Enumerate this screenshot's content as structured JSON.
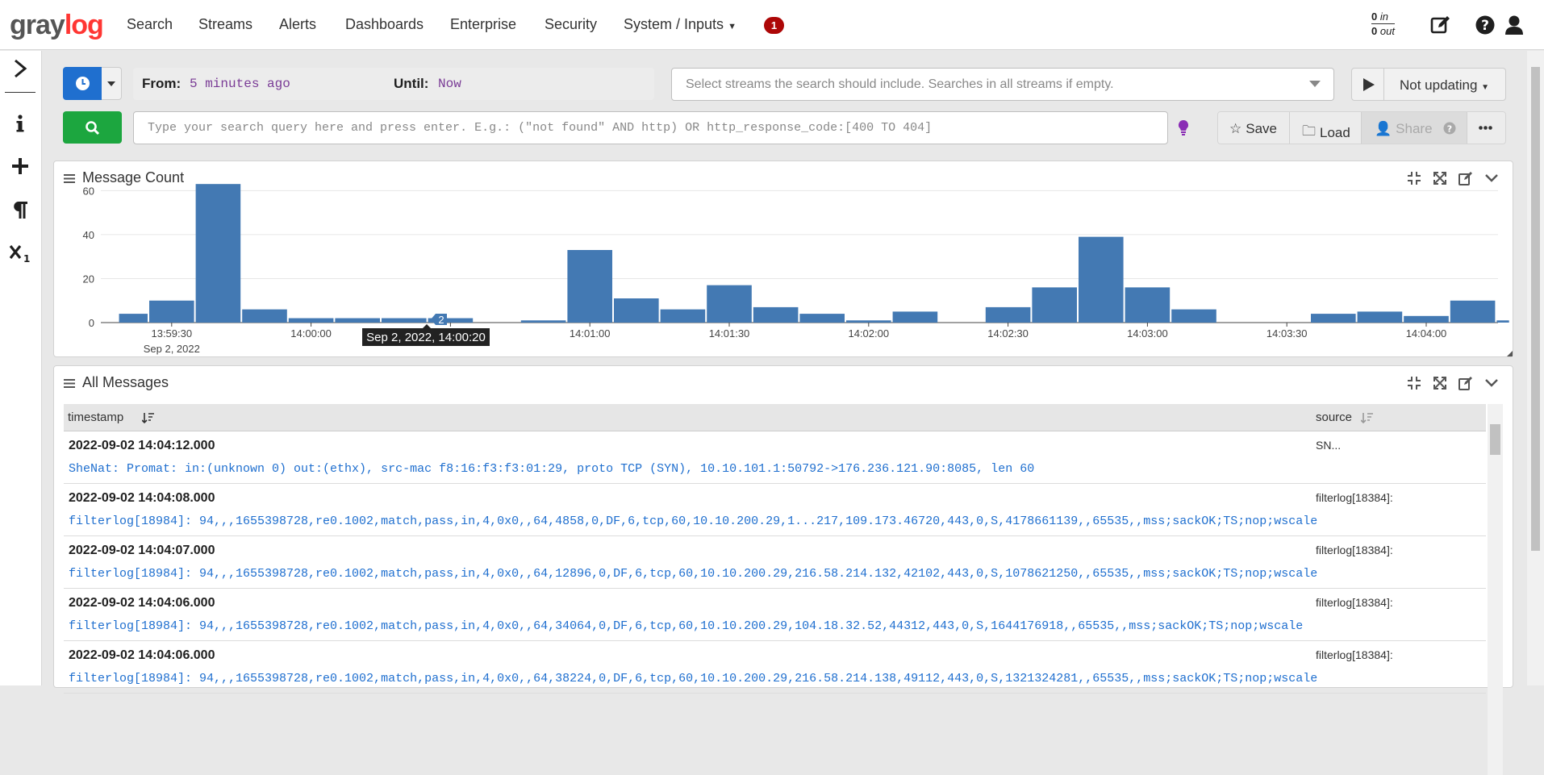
{
  "brand": {
    "part1": "gray",
    "part2": "log"
  },
  "nav": {
    "items": [
      "Search",
      "Streams",
      "Alerts",
      "Dashboards",
      "Enterprise",
      "Security",
      "System / Inputs"
    ],
    "notification_count": "1"
  },
  "throughput": {
    "in_value": "0",
    "in_label": "in",
    "out_value": "0",
    "out_label": "out"
  },
  "search": {
    "from_label": "From:",
    "from_value": "5 minutes ago",
    "until_label": "Until:",
    "until_value": "Now",
    "streams_placeholder": "Select streams the search should include. Searches in all streams if empty.",
    "refresh_label": "Not updating",
    "query_placeholder": "Type your search query here and press enter. E.g.: (\"not found\" AND http) OR http_response_code:[400 TO 404]"
  },
  "actions": {
    "save": "Save",
    "load": "Load",
    "share": "Share"
  },
  "message_count_widget": {
    "title": "Message Count"
  },
  "all_messages_widget": {
    "title": "All Messages",
    "columns": [
      "timestamp",
      "source"
    ],
    "rows": [
      {
        "timestamp": "2022-09-02 14:04:12.000",
        "source": "SN...",
        "message": "SheNat: Promat: in:(unknown 0) out:(ethx), src-mac f8:16:f3:f3:01:29, proto TCP (SYN), 10.10.101.1:50792->176.236.121.90:8085, len 60"
      },
      {
        "timestamp": "2022-09-02 14:04:08.000",
        "source": "filterlog[18384]:",
        "message": "filterlog[18984]: 94,,,1655398728,re0.1002,match,pass,in,4,0x0,,64,4858,0,DF,6,tcp,60,10.10.200.29,1...217,109.173.46720,443,0,S,4178661139,,65535,,mss;sackOK;TS;nop;wscale"
      },
      {
        "timestamp": "2022-09-02 14:04:07.000",
        "source": "filterlog[18384]:",
        "message": "filterlog[18984]: 94,,,1655398728,re0.1002,match,pass,in,4,0x0,,64,12896,0,DF,6,tcp,60,10.10.200.29,216.58.214.132,42102,443,0,S,1078621250,,65535,,mss;sackOK;TS;nop;wscale"
      },
      {
        "timestamp": "2022-09-02 14:04:06.000",
        "source": "filterlog[18384]:",
        "message": "filterlog[18984]: 94,,,1655398728,re0.1002,match,pass,in,4,0x0,,64,34064,0,DF,6,tcp,60,10.10.200.29,104.18.32.52,44312,443,0,S,1644176918,,65535,,mss;sackOK;TS;nop;wscale"
      },
      {
        "timestamp": "2022-09-02 14:04:06.000",
        "source": "filterlog[18384]:",
        "message": "filterlog[18984]: 94,,,1655398728,re0.1002,match,pass,in,4,0x0,,64,38224,0,DF,6,tcp,60,10.10.200.29,216.58.214.138,49112,443,0,S,1321324281,,65535,,mss;sackOK;TS;nop;wscale"
      }
    ]
  },
  "chart_data": {
    "type": "bar",
    "title": "Message Count",
    "ylim": [
      0,
      66
    ],
    "yticks": [
      0,
      20,
      40,
      60
    ],
    "xticks": [
      {
        "label": "13:59:30",
        "sub": "Sep 2, 2022",
        "t": 1.5
      },
      {
        "label": "14:00:00",
        "t": 4.5
      },
      {
        "label": "14:00:30",
        "t": 7.5
      },
      {
        "label": "14:01:00",
        "t": 10.5
      },
      {
        "label": "14:01:30",
        "t": 13.5
      },
      {
        "label": "14:02:00",
        "t": 16.5
      },
      {
        "label": "14:02:30",
        "t": 19.5
      },
      {
        "label": "14:03:00",
        "t": 22.5
      },
      {
        "label": "14:03:30",
        "t": 25.5
      },
      {
        "label": "14:04:00",
        "t": 28.5
      }
    ],
    "bins": [
      0.35,
      1,
      2,
      3,
      4,
      5,
      6,
      7,
      8,
      9,
      10,
      11,
      12,
      13,
      14,
      15,
      16,
      17,
      18,
      19,
      20,
      21,
      22,
      23,
      24,
      25,
      26,
      27,
      28,
      29,
      30
    ],
    "values": [
      4,
      10,
      63,
      6,
      2,
      2,
      2,
      2,
      0,
      1,
      33,
      11,
      6,
      17,
      7,
      4,
      1,
      5,
      0,
      7,
      16,
      39,
      16,
      6,
      0,
      0,
      4,
      5,
      3,
      10,
      1
    ],
    "xmax": 30.3,
    "tooltip": {
      "label": "Sep 2, 2022, 14:00:20",
      "value": "2",
      "t": 7.25
    }
  }
}
